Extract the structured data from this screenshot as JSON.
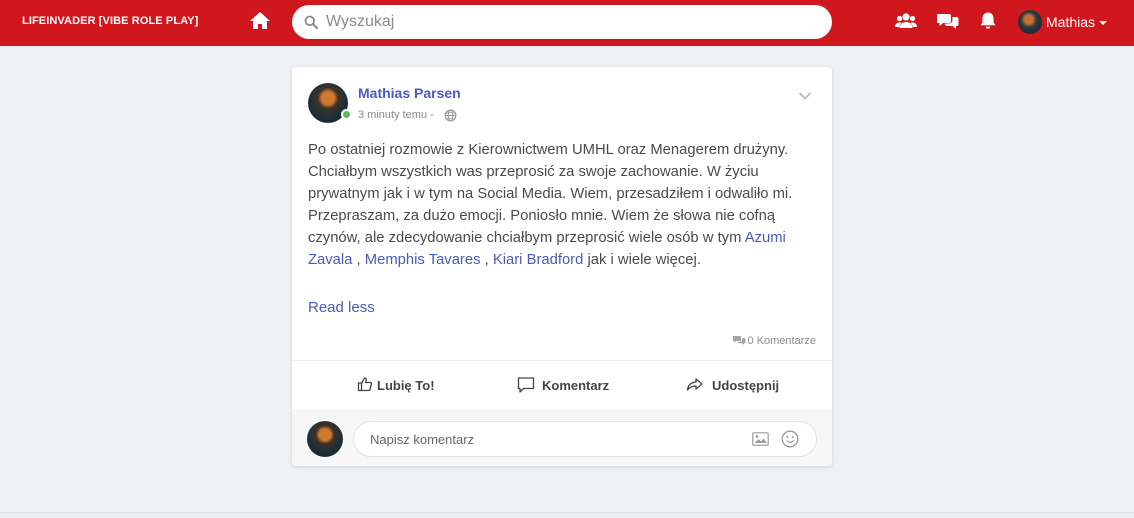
{
  "topbar": {
    "brand": "LIFEINVADER [VIBE ROLE PLAY]",
    "search_placeholder": "Wyszukaj",
    "user_name": "Mathias",
    "icons": [
      "home-icon",
      "search-icon",
      "friends-icon",
      "messages-icon",
      "bell-icon",
      "caret-down-icon"
    ],
    "accent_color": "#d1171e"
  },
  "post": {
    "author": "Mathias Parsen",
    "time": "3 minuty temu -",
    "text_1": "Po ostatniej rozmowie z Kierownictwem UMHL oraz Menagerem drużyny. Chciałbym wszystkich was przeprosić za swoje zachowanie. W życiu prywatnym jak i w tym na Social Media. Wiem, przesadziłem i odwaliło mi. Przepraszam, za dużo emocji. Poniosło mnie. Wiem że słowa nie cofną czynów, ale zdecydowanie chciałbym przeprosić wiele osób w tym",
    "mention_1": "Azumi Zavala",
    "sep_1": ",",
    "mention_2": "Memphis Tavares",
    "sep_2": ",",
    "mention_3": "Kiari Bradford",
    "text_2": "jak i wiele więcej.",
    "read_less": "Read less",
    "comment_count": "0 Komentarze",
    "link_color": "#4a59c4",
    "online_color": "#5cb85c"
  },
  "actions": {
    "like": "Lubię To!",
    "comment": "Komentarz",
    "share": "Udostępnij"
  },
  "comment_box": {
    "placeholder": "Napisz komentarz"
  }
}
